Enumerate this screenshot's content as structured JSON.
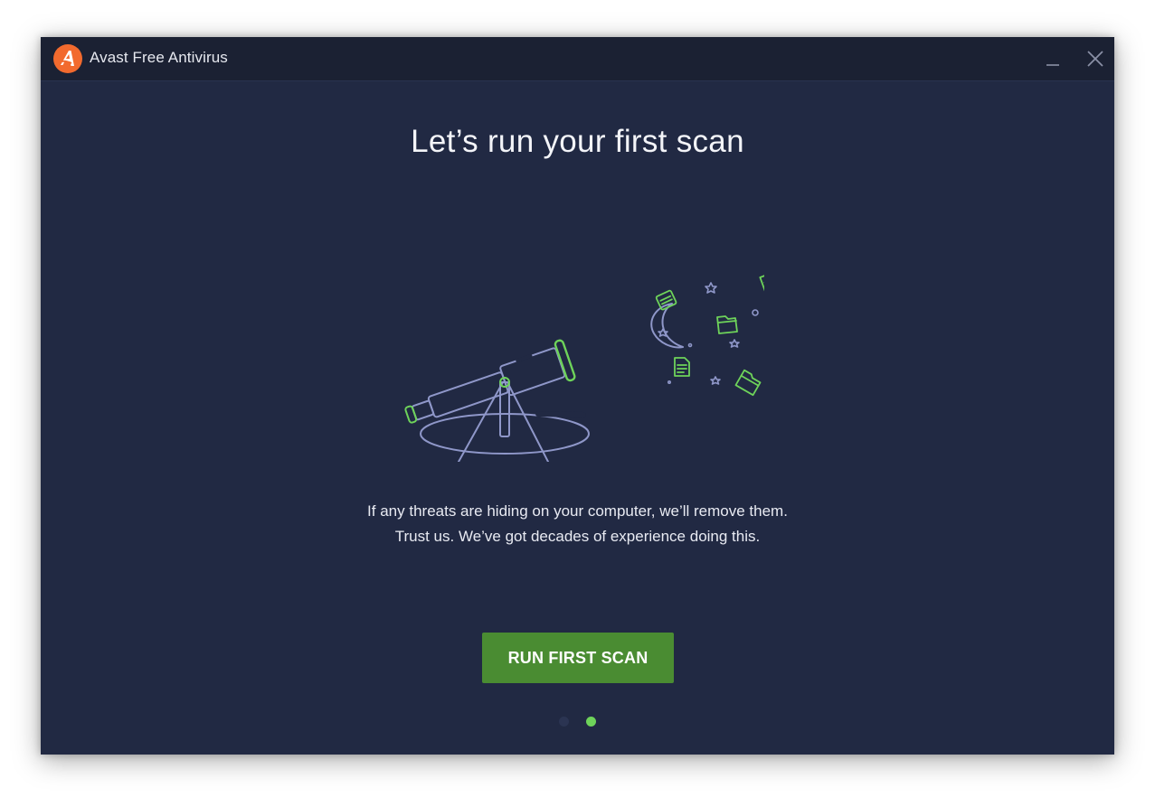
{
  "window": {
    "title": "Avast Free Antivirus"
  },
  "icons": {
    "logo": "avast-logo-icon",
    "minimize": "minimize-icon",
    "close": "close-icon",
    "illustration": "telescope-illustration"
  },
  "main": {
    "headline": "Let’s run your first scan",
    "description_line1": "If any threats are hiding on your computer, we’ll remove them.",
    "description_line2": "Trust us. We’ve got decades of experience doing this.",
    "cta_label": "RUN FIRST SCAN"
  },
  "pager": {
    "total": 2,
    "active_index": 2
  },
  "colors": {
    "background": "#212943",
    "titlebar": "#1b2133",
    "accent_green": "#4a8c32",
    "indicator_green": "#6ed35a",
    "logo_orange": "#f26a2e",
    "line_lavender": "#8f97c9"
  }
}
